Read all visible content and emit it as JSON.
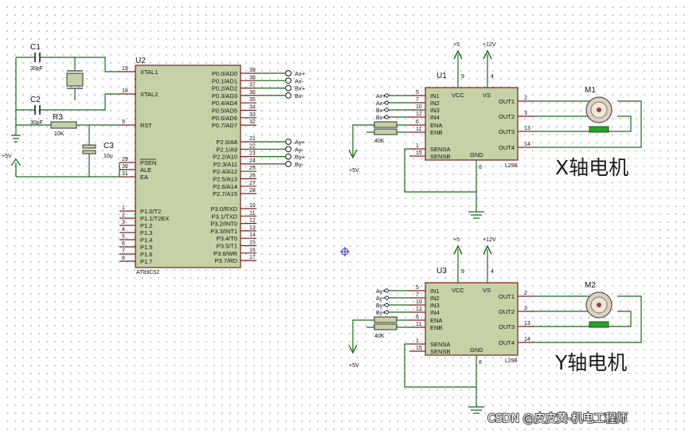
{
  "u2": {
    "ref": "U2",
    "part": "AT89C52",
    "left_pins": [
      {
        "num": "19",
        "name": "XTAL1"
      },
      {
        "num": "18",
        "name": "XTAL2"
      },
      {
        "num": "9",
        "name": "RST"
      },
      {
        "num": "29",
        "name": "PSEN"
      },
      {
        "num": "30",
        "name": "ALE"
      },
      {
        "num": "31",
        "name": "EA"
      },
      {
        "num": "1",
        "name": "P1.0/T2"
      },
      {
        "num": "2",
        "name": "P1.1/T2EX"
      },
      {
        "num": "3",
        "name": "P1.2"
      },
      {
        "num": "4",
        "name": "P1.3"
      },
      {
        "num": "5",
        "name": "P1.4"
      },
      {
        "num": "6",
        "name": "P1.5"
      },
      {
        "num": "7",
        "name": "P1.6"
      },
      {
        "num": "8",
        "name": "P1.7"
      }
    ],
    "right_pins": [
      {
        "num": "39",
        "name": "P0.0/AD0"
      },
      {
        "num": "38",
        "name": "P0.1/AD1"
      },
      {
        "num": "37",
        "name": "P0.2/AD2"
      },
      {
        "num": "36",
        "name": "P0.3/AD3"
      },
      {
        "num": "35",
        "name": "P0.4/AD4"
      },
      {
        "num": "34",
        "name": "P0.5/AD5"
      },
      {
        "num": "33",
        "name": "P0.6/AD6"
      },
      {
        "num": "32",
        "name": "P0.7/AD7"
      },
      {
        "num": "21",
        "name": "P2.0/A8"
      },
      {
        "num": "22",
        "name": "P2.1/A9"
      },
      {
        "num": "23",
        "name": "P2.2/A10"
      },
      {
        "num": "24",
        "name": "P2.3/A11"
      },
      {
        "num": "25",
        "name": "P2.4/A12"
      },
      {
        "num": "26",
        "name": "P2.5/A13"
      },
      {
        "num": "27",
        "name": "P2.6/A14"
      },
      {
        "num": "28",
        "name": "P2.7/A15"
      },
      {
        "num": "10",
        "name": "P3.0/RXD"
      },
      {
        "num": "11",
        "name": "P3.1/TXD"
      },
      {
        "num": "12",
        "name": "P3.2/INT0"
      },
      {
        "num": "13",
        "name": "P3.3/INT1"
      },
      {
        "num": "14",
        "name": "P3.4/T0"
      },
      {
        "num": "15",
        "name": "P3.5/T1"
      },
      {
        "num": "16",
        "name": "P3.6/WR"
      },
      {
        "num": "17",
        "name": "P3.7/RD"
      }
    ],
    "out_terminals_x": [
      "Ax+",
      "Ax-",
      "Bx+",
      "Bx-"
    ],
    "out_terminals_y": [
      "Ay+",
      "Ay-",
      "By+",
      "By-"
    ]
  },
  "c1": {
    "ref": "C1",
    "value": "30pF"
  },
  "c2": {
    "ref": "C2",
    "value": "30pF"
  },
  "r3": {
    "ref": "R3",
    "value": "10K"
  },
  "c3": {
    "ref": "C3",
    "value": "10u"
  },
  "vcc_label": "+5V",
  "u1": {
    "ref": "U1",
    "part": "L298",
    "inputs": [
      "Ax+",
      "Ax-",
      "Bx-",
      "Bx+"
    ],
    "motor": "M1",
    "title": "X轴电机",
    "r_value": "40K"
  },
  "u3": {
    "ref": "U3",
    "part": "L298",
    "inputs": [
      "Ay+",
      "Ay-",
      "By-",
      "By+"
    ],
    "motor": "M2",
    "title": "Y轴电机",
    "r_value": "40K"
  },
  "l298_pins": {
    "left": [
      {
        "num": "5",
        "name": "IN1"
      },
      {
        "num": "7",
        "name": "IN2"
      },
      {
        "num": "10",
        "name": "IN3"
      },
      {
        "num": "12",
        "name": "IN4"
      },
      {
        "num": "6",
        "name": "ENA"
      },
      {
        "num": "11",
        "name": "ENB"
      },
      {
        "num": "1",
        "name": "SENSA"
      },
      {
        "num": "15",
        "name": "SENSB"
      }
    ],
    "right": [
      {
        "num": "2",
        "name": "OUT1"
      },
      {
        "num": "3",
        "name": "OUT2"
      },
      {
        "num": "13",
        "name": "OUT3"
      },
      {
        "num": "14",
        "name": "OUT4"
      }
    ],
    "top": [
      {
        "num": "9",
        "name": "VCC"
      },
      {
        "num": "4",
        "name": "VS"
      }
    ],
    "bottom": {
      "num": "8",
      "name": "GND"
    },
    "supply_vcc": "+5",
    "supply_vs": "+12V"
  },
  "watermark": "CSDN @皮皮黄-机电工程师"
}
